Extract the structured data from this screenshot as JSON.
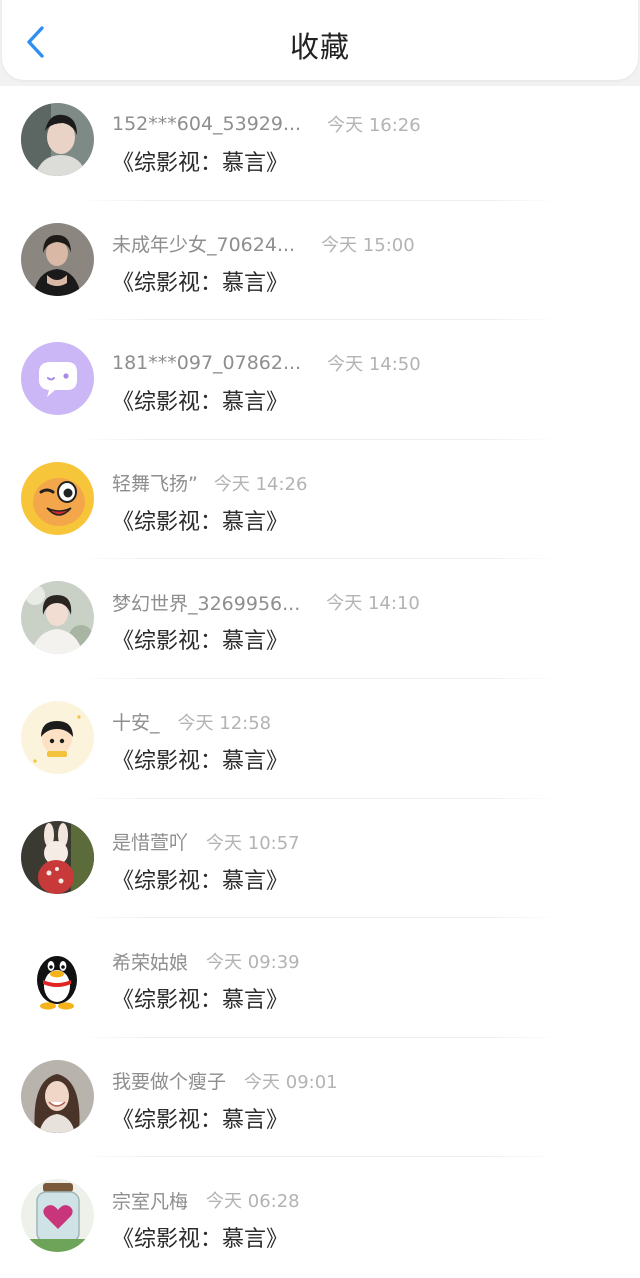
{
  "header": {
    "title": "收藏",
    "back_icon": "chevron-left-icon",
    "accent_color": "#2f8ff0"
  },
  "items": [
    {
      "name": "152***604_53929...",
      "time": "今天 16:26",
      "book": "《综影视：慕言》",
      "avatar_icon": "photo-avatar-man"
    },
    {
      "name": "未成年少女_70624...",
      "time": "今天 15:00",
      "book": "《综影视：慕言》",
      "avatar_icon": "photo-avatar-girl"
    },
    {
      "name": "181***097_07862...",
      "time": "今天 14:50",
      "book": "《综影视：慕言》",
      "avatar_icon": "default-chat-avatar"
    },
    {
      "name": "轻舞飞扬”",
      "time": "今天 14:26",
      "book": "《综影视：慕言》",
      "avatar_icon": "cartoon-wink-avatar"
    },
    {
      "name": "梦幻世界_3269956...",
      "time": "今天 14:10",
      "book": "《综影视：慕言》",
      "avatar_icon": "photo-avatar-woman"
    },
    {
      "name": "十安_",
      "time": "今天 12:58",
      "book": "《综影视：慕言》",
      "avatar_icon": "cartoon-kid-avatar"
    },
    {
      "name": "是惜萱吖",
      "time": "今天 10:57",
      "book": "《综影视：慕言》",
      "avatar_icon": "bunny-doll-avatar"
    },
    {
      "name": "希荣姑娘",
      "time": "今天 09:39",
      "book": "《综影视：慕言》",
      "avatar_icon": "qq-penguin-avatar"
    },
    {
      "name": "我要做个瘦子",
      "time": "今天 09:01",
      "book": "《综影视：慕言》",
      "avatar_icon": "photo-avatar-smiling-woman"
    },
    {
      "name": "宗室凡梅",
      "time": "今天 06:28",
      "book": "《综影视：慕言》",
      "avatar_icon": "heart-jar-avatar"
    }
  ]
}
